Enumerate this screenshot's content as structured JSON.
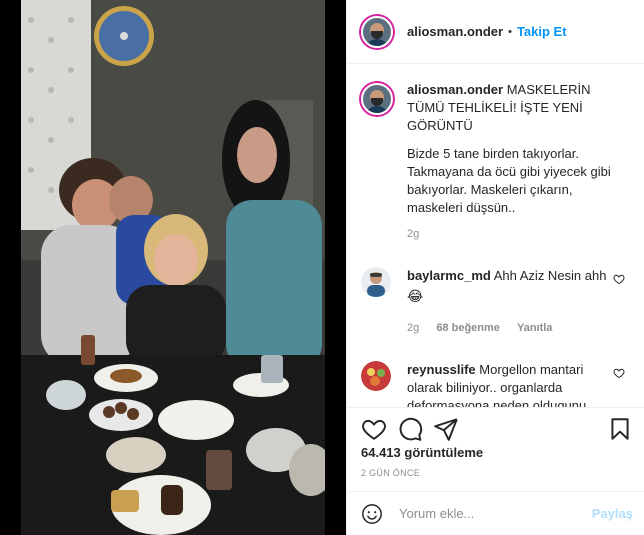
{
  "post": {
    "username": "aliosman.onder",
    "follow_label": "Takip Et",
    "separator": "•"
  },
  "caption": {
    "username": "aliosman.onder",
    "headline": "MASKELERİN TÜMÜ TEHLİKELİ! İŞTE YENİ GÖRÜNTÜ",
    "body": "Bizde 5 tane birden takıyorlar. Takmayana da öcü gibi yiyecek gibi bakıyorlar. Maskeleri çıkarın, maskeleri düşsün..",
    "time": "2g"
  },
  "comments": [
    {
      "username": "baylarmc_md",
      "text": "Ahh Aziz Nesin ahh",
      "emoji": "😂",
      "time": "2g",
      "likes": "68 beğenme",
      "reply": "Yanıtla"
    },
    {
      "username": "reynusslife",
      "text": "Morgellon mantari olarak biliniyor.. organlarda deformasyona neden oldugunu söyleyen bir cok sayfa var.."
    }
  ],
  "stats": {
    "views_count": "64.413",
    "views_label": "görüntüleme",
    "date": "2 GÜN ÖNCE"
  },
  "composer": {
    "placeholder": "Yorum ekle...",
    "post_label": "Paylaş"
  },
  "icons": {
    "like": "heart-icon",
    "comment": "comment-icon",
    "share": "paper-plane-icon",
    "save": "bookmark-icon",
    "emoji": "smiley-icon",
    "comment_like": "small-heart-icon"
  },
  "colors": {
    "accent": "#0095f6",
    "muted": "#8e8e8e",
    "text": "#262626",
    "post_disabled": "#b2dffc"
  }
}
